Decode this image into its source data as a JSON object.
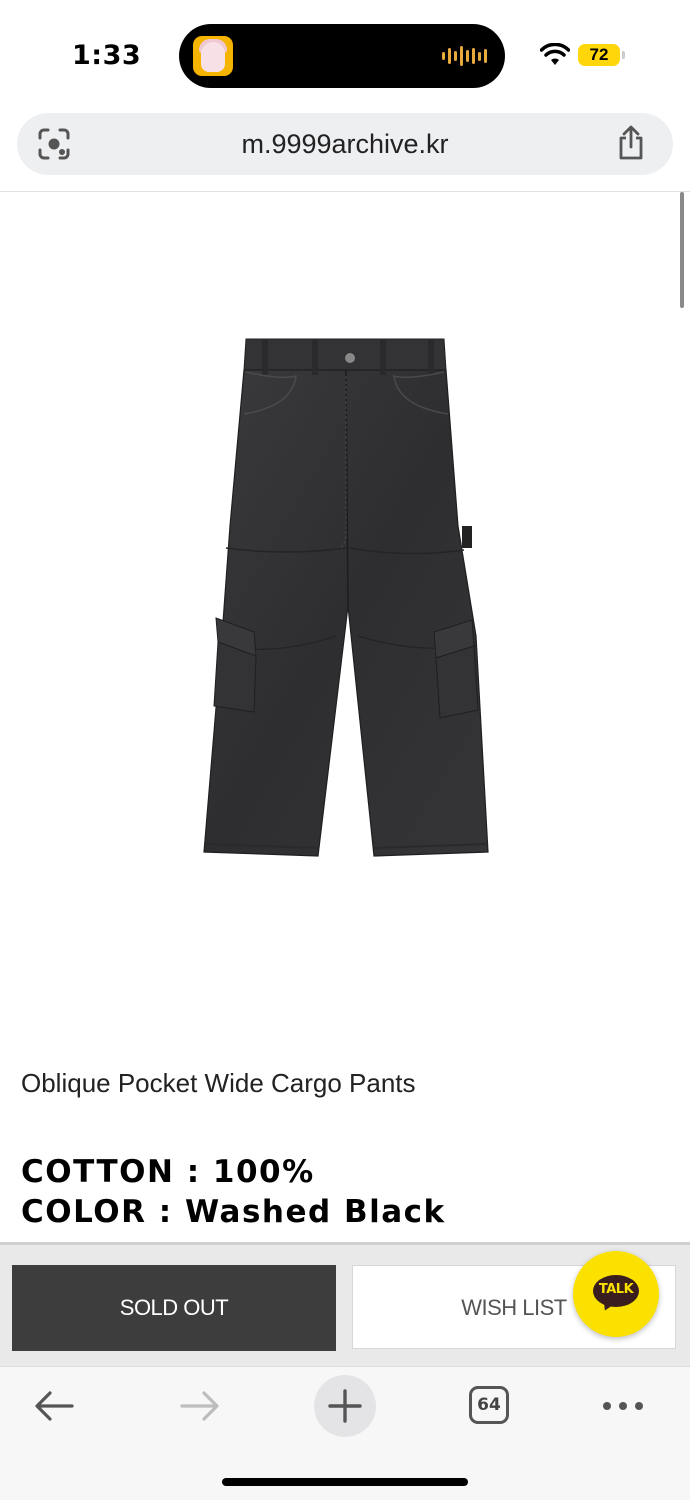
{
  "status": {
    "time": "1:33",
    "battery": "72"
  },
  "browser": {
    "url": "m.9999archive.kr",
    "tab_count": "64"
  },
  "product": {
    "name": "Oblique Pocket Wide Cargo Pants",
    "spec_cotton": "COTTON : 100%",
    "spec_color": "COLOR : Washed Black"
  },
  "actions": {
    "sold_out_label": "SOLD OUT",
    "wish_list_label": "WISH LIST",
    "talk_label": "TALK"
  },
  "colors": {
    "sold_out_bg": "#3d3d3d",
    "talk_yellow": "#fae100",
    "battery_yellow": "#ffd60a"
  },
  "icons": {
    "url_left": "camera-lens-icon",
    "url_right": "share-icon",
    "toolbar": [
      "back-arrow-icon",
      "forward-arrow-icon",
      "plus-icon",
      "tabs-icon",
      "more-icon"
    ]
  }
}
